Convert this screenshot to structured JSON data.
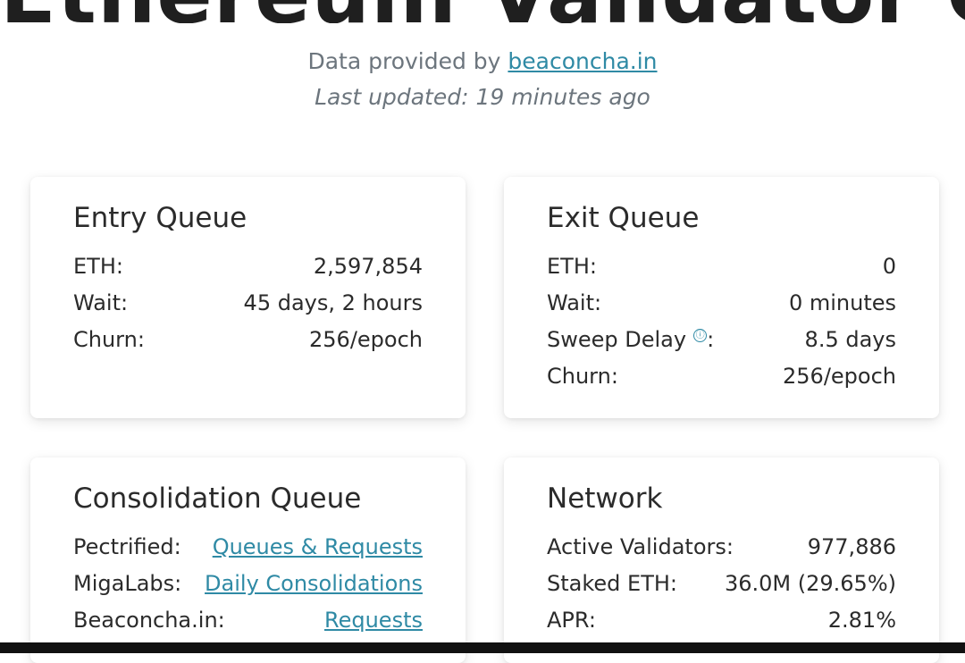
{
  "header": {
    "title": "Ethereum Validator Queue",
    "provided_prefix": "Data provided by ",
    "provided_link": "beaconcha.in",
    "last_updated": "Last updated: 19 minutes ago"
  },
  "entry_queue": {
    "title": "Entry Queue",
    "rows": [
      {
        "label": "ETH:",
        "value": "2,597,854"
      },
      {
        "label": "Wait:",
        "value": "45 days, 2 hours"
      },
      {
        "label": "Churn:",
        "value": "256/epoch"
      }
    ]
  },
  "exit_queue": {
    "title": "Exit Queue",
    "rows": [
      {
        "label": "ETH:",
        "value": "0"
      },
      {
        "label": "Wait:",
        "value": "0 minutes"
      },
      {
        "label": "Sweep Delay",
        "info_icon": "ⓘ",
        "suffix": ":",
        "value": "8.5 days"
      },
      {
        "label": "Churn:",
        "value": "256/epoch"
      }
    ]
  },
  "consolidation_queue": {
    "title": "Consolidation Queue",
    "rows": [
      {
        "label": "Pectrified:",
        "value": "Queues & Requests"
      },
      {
        "label": "MigaLabs:",
        "value": "Daily Consolidations"
      },
      {
        "label": "Beaconcha.in:",
        "value": "Requests"
      }
    ]
  },
  "network": {
    "title": "Network",
    "rows": [
      {
        "label": "Active Validators:",
        "value": "977,886"
      },
      {
        "label": "Staked ETH:",
        "value": "36.0M (29.65%)"
      },
      {
        "label": "APR:",
        "value": "2.81%"
      }
    ]
  },
  "colors": {
    "link": "#2f8aa5",
    "muted": "#6c757d",
    "text": "#2b2b2b"
  }
}
